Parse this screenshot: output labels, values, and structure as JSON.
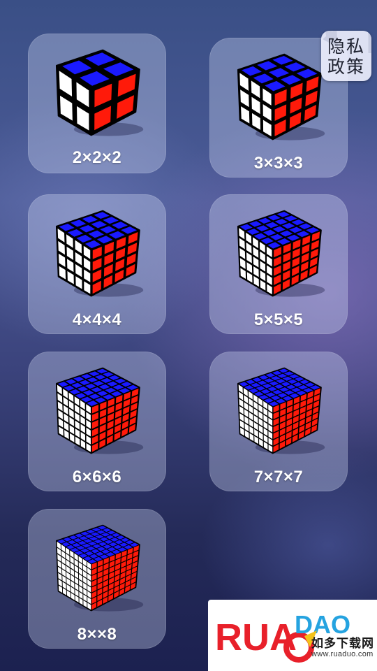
{
  "puzzles": [
    {
      "label": "2×2×2",
      "n": 2
    },
    {
      "label": "3×3×3",
      "n": 3
    },
    {
      "label": "4×4×4",
      "n": 4
    },
    {
      "label": "5×5×5",
      "n": 5
    },
    {
      "label": "6×6×6",
      "n": 6
    },
    {
      "label": "7×7×7",
      "n": 7
    },
    {
      "label": "8××8",
      "n": 8
    }
  ],
  "privacy": {
    "label": "隐私政策",
    "icon": "back-arrow-icon"
  },
  "watermark": {
    "logo_text": "RUAODAO",
    "title": "如多下载网",
    "url": "www.ruaduo.com"
  },
  "colors": {
    "top": "#1a1aff",
    "left": "#ffffff",
    "right": "#ff1a0a",
    "gap": "#000000"
  }
}
